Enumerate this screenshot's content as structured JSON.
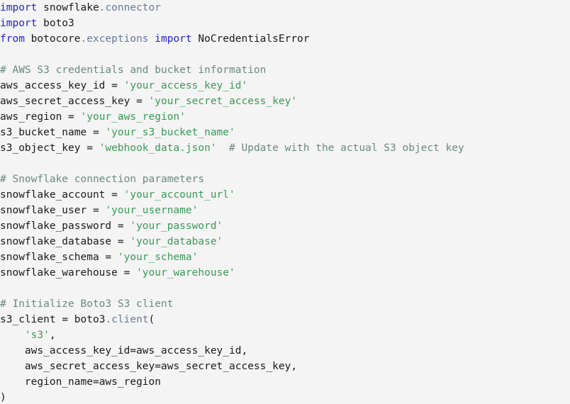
{
  "editor": {
    "language": "python",
    "background_color": "#f4f4f4",
    "theme_colors": {
      "keyword": "#2222dd",
      "plain": "#1a1a1a",
      "attribute": "#6a7a9a",
      "string": "#3a9a56",
      "comment": "#6a8a80"
    }
  },
  "code": {
    "lines": [
      {
        "id": "line-1",
        "tokens": [
          {
            "t": "keyword",
            "v": "import"
          },
          {
            "t": "plain",
            "v": " snowflake"
          },
          {
            "t": "attr",
            "v": ".connector"
          }
        ]
      },
      {
        "id": "line-2",
        "tokens": [
          {
            "t": "keyword",
            "v": "import"
          },
          {
            "t": "plain",
            "v": " boto3"
          }
        ]
      },
      {
        "id": "line-3",
        "tokens": [
          {
            "t": "keyword",
            "v": "from"
          },
          {
            "t": "plain",
            "v": " botocore"
          },
          {
            "t": "attr",
            "v": ".exceptions"
          },
          {
            "t": "plain",
            "v": " "
          },
          {
            "t": "keyword",
            "v": "import"
          },
          {
            "t": "plain",
            "v": " NoCredentialsError"
          }
        ]
      },
      {
        "id": "line-4",
        "tokens": []
      },
      {
        "id": "line-5",
        "tokens": [
          {
            "t": "comment",
            "v": "# AWS S3 credentials and bucket information"
          }
        ]
      },
      {
        "id": "line-6",
        "tokens": [
          {
            "t": "plain",
            "v": "aws_access_key_id "
          },
          {
            "t": "op",
            "v": "="
          },
          {
            "t": "plain",
            "v": " "
          },
          {
            "t": "string",
            "v": "'your_access_key_id'"
          }
        ]
      },
      {
        "id": "line-7",
        "tokens": [
          {
            "t": "plain",
            "v": "aws_secret_access_key "
          },
          {
            "t": "op",
            "v": "="
          },
          {
            "t": "plain",
            "v": " "
          },
          {
            "t": "string",
            "v": "'your_secret_access_key'"
          }
        ]
      },
      {
        "id": "line-8",
        "tokens": [
          {
            "t": "plain",
            "v": "aws_region "
          },
          {
            "t": "op",
            "v": "="
          },
          {
            "t": "plain",
            "v": " "
          },
          {
            "t": "string",
            "v": "'your_aws_region'"
          }
        ]
      },
      {
        "id": "line-9",
        "tokens": [
          {
            "t": "plain",
            "v": "s3_bucket_name "
          },
          {
            "t": "op",
            "v": "="
          },
          {
            "t": "plain",
            "v": " "
          },
          {
            "t": "string",
            "v": "'your_s3_bucket_name'"
          }
        ]
      },
      {
        "id": "line-10",
        "tokens": [
          {
            "t": "plain",
            "v": "s3_object_key "
          },
          {
            "t": "op",
            "v": "="
          },
          {
            "t": "plain",
            "v": " "
          },
          {
            "t": "string",
            "v": "'webhook_data.json'"
          },
          {
            "t": "plain",
            "v": "  "
          },
          {
            "t": "comment",
            "v": "# Update with the actual S3 object key"
          }
        ]
      },
      {
        "id": "line-11",
        "tokens": []
      },
      {
        "id": "line-12",
        "tokens": [
          {
            "t": "comment",
            "v": "# Snowflake connection parameters"
          }
        ]
      },
      {
        "id": "line-13",
        "tokens": [
          {
            "t": "plain",
            "v": "snowflake_account "
          },
          {
            "t": "op",
            "v": "="
          },
          {
            "t": "plain",
            "v": " "
          },
          {
            "t": "string",
            "v": "'your_account_url'"
          }
        ]
      },
      {
        "id": "line-14",
        "tokens": [
          {
            "t": "plain",
            "v": "snowflake_user "
          },
          {
            "t": "op",
            "v": "="
          },
          {
            "t": "plain",
            "v": " "
          },
          {
            "t": "string",
            "v": "'your_username'"
          }
        ]
      },
      {
        "id": "line-15",
        "tokens": [
          {
            "t": "plain",
            "v": "snowflake_password "
          },
          {
            "t": "op",
            "v": "="
          },
          {
            "t": "plain",
            "v": " "
          },
          {
            "t": "string",
            "v": "'your_password'"
          }
        ]
      },
      {
        "id": "line-16",
        "tokens": [
          {
            "t": "plain",
            "v": "snowflake_database "
          },
          {
            "t": "op",
            "v": "="
          },
          {
            "t": "plain",
            "v": " "
          },
          {
            "t": "string",
            "v": "'your_database'"
          }
        ]
      },
      {
        "id": "line-17",
        "tokens": [
          {
            "t": "plain",
            "v": "snowflake_schema "
          },
          {
            "t": "op",
            "v": "="
          },
          {
            "t": "plain",
            "v": " "
          },
          {
            "t": "string",
            "v": "'your_schema'"
          }
        ]
      },
      {
        "id": "line-18",
        "tokens": [
          {
            "t": "plain",
            "v": "snowflake_warehouse "
          },
          {
            "t": "op",
            "v": "="
          },
          {
            "t": "plain",
            "v": " "
          },
          {
            "t": "string",
            "v": "'your_warehouse'"
          }
        ]
      },
      {
        "id": "line-19",
        "tokens": []
      },
      {
        "id": "line-20",
        "tokens": [
          {
            "t": "comment",
            "v": "# Initialize Boto3 S3 client"
          }
        ]
      },
      {
        "id": "line-21",
        "tokens": [
          {
            "t": "plain",
            "v": "s3_client "
          },
          {
            "t": "op",
            "v": "="
          },
          {
            "t": "plain",
            "v": " boto3"
          },
          {
            "t": "attr",
            "v": ".client"
          },
          {
            "t": "punct",
            "v": "("
          }
        ]
      },
      {
        "id": "line-22",
        "tokens": [
          {
            "t": "plain",
            "v": "    "
          },
          {
            "t": "string",
            "v": "'s3'"
          },
          {
            "t": "punct",
            "v": ","
          }
        ]
      },
      {
        "id": "line-23",
        "tokens": [
          {
            "t": "plain",
            "v": "    aws_access_key_id"
          },
          {
            "t": "op",
            "v": "="
          },
          {
            "t": "plain",
            "v": "aws_access_key_id"
          },
          {
            "t": "punct",
            "v": ","
          }
        ]
      },
      {
        "id": "line-24",
        "tokens": [
          {
            "t": "plain",
            "v": "    aws_secret_access_key"
          },
          {
            "t": "op",
            "v": "="
          },
          {
            "t": "plain",
            "v": "aws_secret_access_key"
          },
          {
            "t": "punct",
            "v": ","
          }
        ]
      },
      {
        "id": "line-25",
        "tokens": [
          {
            "t": "plain",
            "v": "    region_name"
          },
          {
            "t": "op",
            "v": "="
          },
          {
            "t": "plain",
            "v": "aws_region"
          }
        ]
      },
      {
        "id": "line-26",
        "tokens": [
          {
            "t": "punct",
            "v": ")"
          }
        ]
      }
    ]
  }
}
